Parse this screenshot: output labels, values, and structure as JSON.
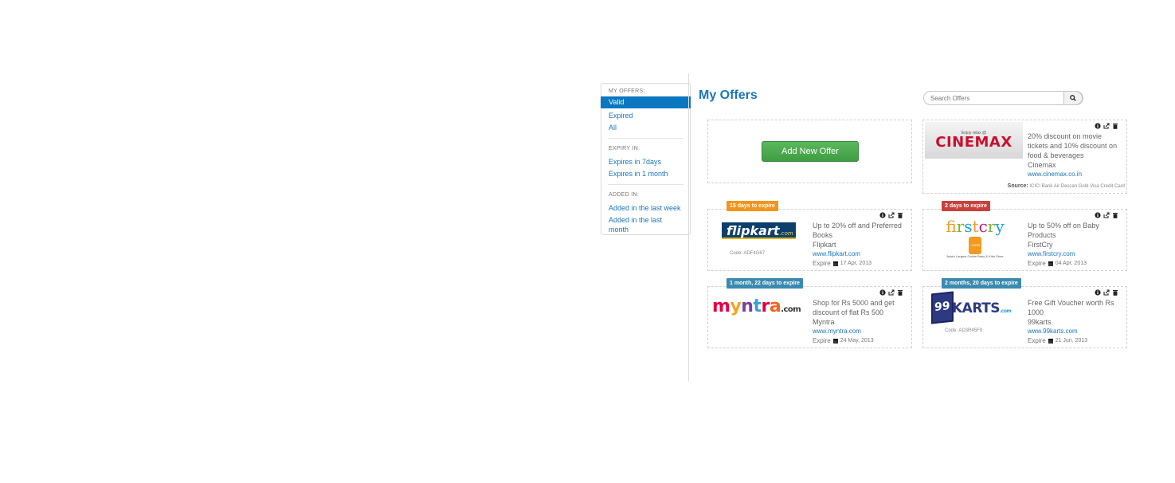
{
  "sidebar": {
    "my_offers_heading": "MY OFFERS:",
    "my_offers_items": [
      "Valid",
      "Expired",
      "All"
    ],
    "expiry_heading": "EXPIRY IN:",
    "expiry_items": [
      "Expires in 7days",
      "Expires in 1 month"
    ],
    "added_heading": "ADDED IN:",
    "added_items": [
      "Added in the last week",
      "Added in the last month"
    ]
  },
  "page_title": "My Offers",
  "search": {
    "placeholder": "Search Offers",
    "icon": "search-icon"
  },
  "add_button_label": "Add New Offer",
  "action_icons": [
    "info-icon",
    "share-icon",
    "trash-icon"
  ],
  "offers": [
    {
      "id": "cinemax",
      "logo_small": "Enjoy relax @",
      "logo_text": "CINEMAX",
      "text": "20% discount on movie tickets and 10% discount on food & beverages",
      "merchant": "Cinemax",
      "url": "www.cinemax.co.in",
      "source_label": "Source:",
      "source_value": "ICICI Bank Air Deccan Gold Visa Credit Card"
    },
    {
      "id": "flipkart",
      "badge": "15 days to expire",
      "logo_text": "flipkart",
      "logo_suffix": ".com",
      "code": "Code: ADF4G67",
      "text": "Up to 20% off and Preferred Books",
      "merchant": "Flipkart",
      "url": "www.flipkart.com",
      "expire_label": "Expire",
      "expire_date": "17 Apr, 2013"
    },
    {
      "id": "firstcry",
      "badge": "2 days to expire",
      "logo_tagline": "Asia's Largest Online Baby & Kids Store",
      "logo_suffix": ".com",
      "text": "Up to 50% off on Baby Products",
      "merchant": "FirstCry",
      "url": "www.firstcry.com",
      "expire_label": "Expire",
      "expire_date": "04 Apr, 2013"
    },
    {
      "id": "myntra",
      "badge": "1 month, 22 days to expire",
      "logo_suffix": ".com",
      "text": "Shop for Rs 5000 and get discount of flat Rs 500",
      "merchant": "Myntra",
      "url": "www.myntra.com",
      "expire_label": "Expire",
      "expire_date": "24 May, 2013"
    },
    {
      "id": "99karts",
      "badge": "2 months, 20 days to expire",
      "logo_box": "99",
      "logo_text": "KARTS",
      "logo_suffix": ".com",
      "code": "Code: AD3R45F9",
      "text": "Free Gift Voucher worth Rs 1000",
      "merchant": "99karts",
      "url": "www.99karts.com",
      "expire_label": "Expire",
      "expire_date": "21 Jun, 2013"
    }
  ]
}
